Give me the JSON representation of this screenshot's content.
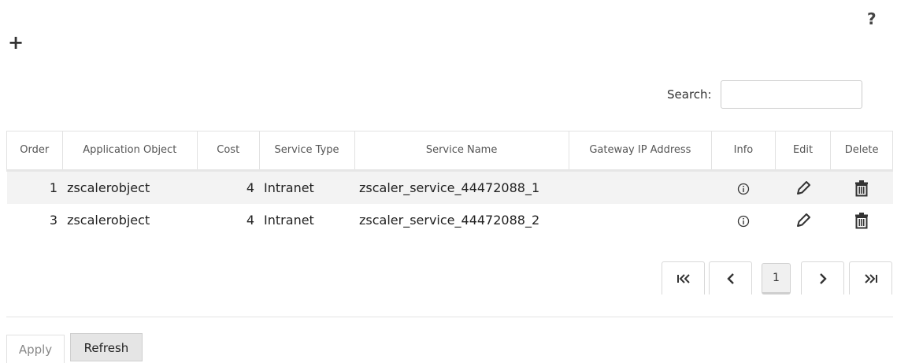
{
  "toolbar": {
    "help_label": "?",
    "add_label": "+"
  },
  "search": {
    "label": "Search:",
    "value": "",
    "placeholder": ""
  },
  "table": {
    "headers": [
      "Order",
      "Application Object",
      "Cost",
      "Service Type",
      "Service Name",
      "Gateway IP Address",
      "Info",
      "Edit",
      "Delete"
    ],
    "rows": [
      {
        "order": "1",
        "application_object": "zscalerobject",
        "cost": "4",
        "service_type": "Intranet",
        "service_name": "zscaler_service_44472088_1",
        "gateway_ip": ""
      },
      {
        "order": "3",
        "application_object": "zscalerobject",
        "cost": "4",
        "service_type": "Intranet",
        "service_name": "zscaler_service_44472088_2",
        "gateway_ip": ""
      }
    ],
    "row_icons": {
      "info": "info-icon",
      "edit": "pencil-icon",
      "delete": "trash-icon"
    }
  },
  "pagination": {
    "first_icon": "first-page-icon",
    "prev_icon": "chevron-left-icon",
    "current_page": "1",
    "next_icon": "chevron-right-icon",
    "last_icon": "last-page-icon"
  },
  "actions": {
    "apply_label": "Apply",
    "refresh_label": "Refresh"
  },
  "colors": {
    "row_stripe": "#f3f3f3",
    "border": "#e2e2e2",
    "icon": "#333333"
  }
}
